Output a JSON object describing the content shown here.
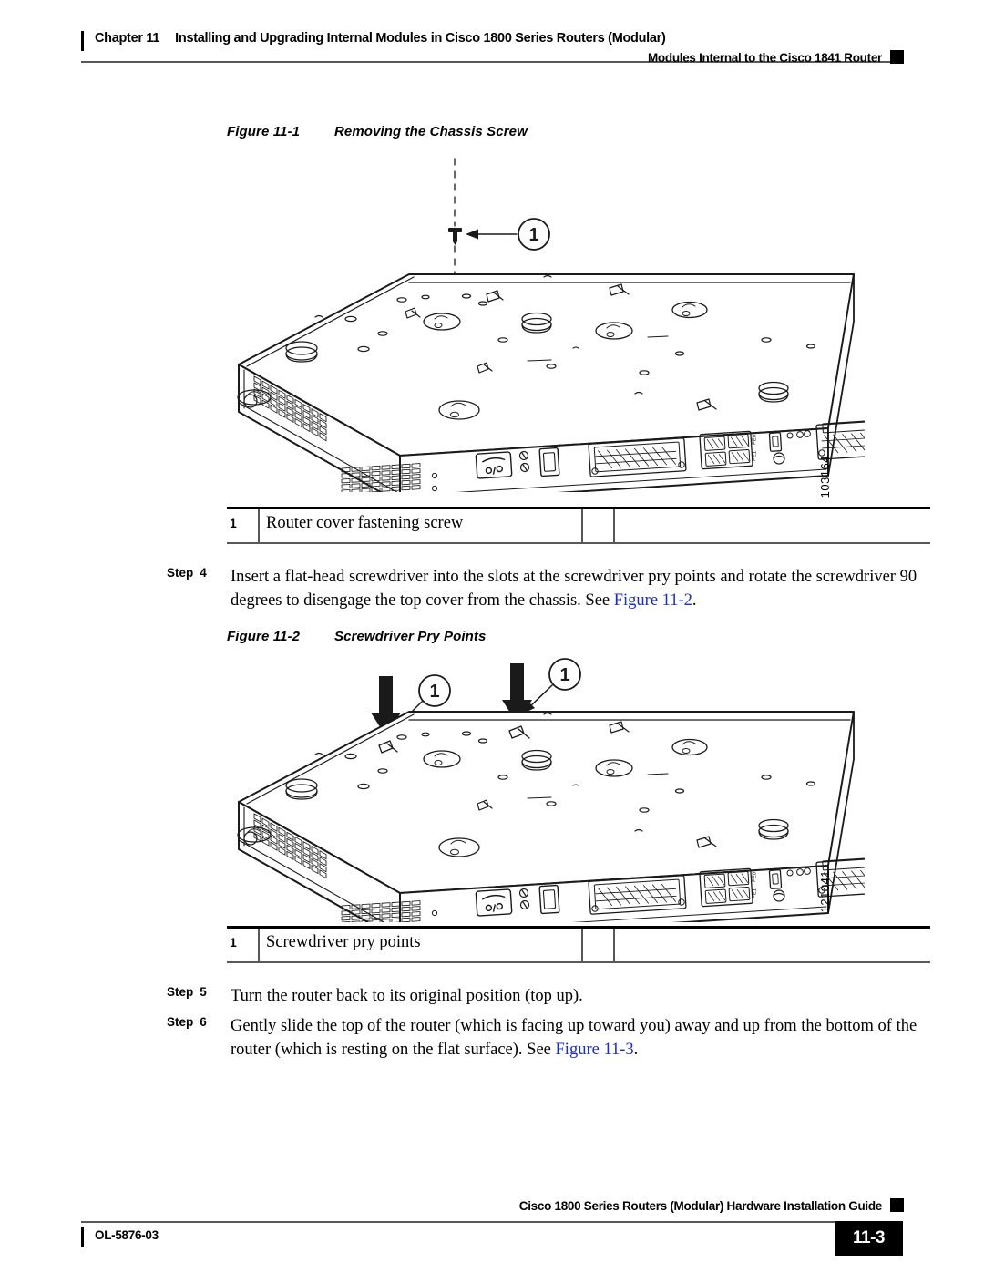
{
  "header": {
    "chapter_label": "Chapter 11",
    "chapter_title": "Installing and Upgrading Internal Modules in Cisco 1800 Series Routers (Modular)",
    "section_title": "Modules Internal to the Cisco 1841 Router"
  },
  "figures": [
    {
      "number_label": "Figure 11-1",
      "title": "Removing the Chassis Screw",
      "image_number": "103164",
      "callouts": [
        "1"
      ],
      "legend": {
        "number": "1",
        "text": "Router cover fastening screw"
      }
    },
    {
      "number_label": "Figure 11-2",
      "title": "Screwdriver Pry Points",
      "image_number": "121041",
      "callouts": [
        "1",
        "1"
      ],
      "legend": {
        "number": "1",
        "text": "Screwdriver pry points"
      }
    }
  ],
  "steps": [
    {
      "label": "Step",
      "number": "4",
      "text_before": "Insert a flat-head screwdriver into the slots at the screwdriver pry points and rotate the screwdriver 90 degrees to disengage the top cover from the chassis. See ",
      "xref": "Figure 11-2",
      "text_after": "."
    },
    {
      "label": "Step",
      "number": "5",
      "text_before": "Turn the router back to its original position (top up).",
      "xref": "",
      "text_after": ""
    },
    {
      "label": "Step",
      "number": "6",
      "text_before": "Gently slide the top of the router (which is facing up toward you) away and up from the bottom of the router (which is resting on the flat surface). See ",
      "xref": "Figure 11-3",
      "text_after": "."
    }
  ],
  "footer": {
    "guide_title": "Cisco 1800 Series Routers (Modular) Hardware Installation Guide",
    "doc_number": "OL-5876-03",
    "page_number": "11-3"
  },
  "colors": {
    "link": "#1a2ec4",
    "rule": "#58585a",
    "ink": "#000000",
    "page_background": "#ffffff"
  }
}
